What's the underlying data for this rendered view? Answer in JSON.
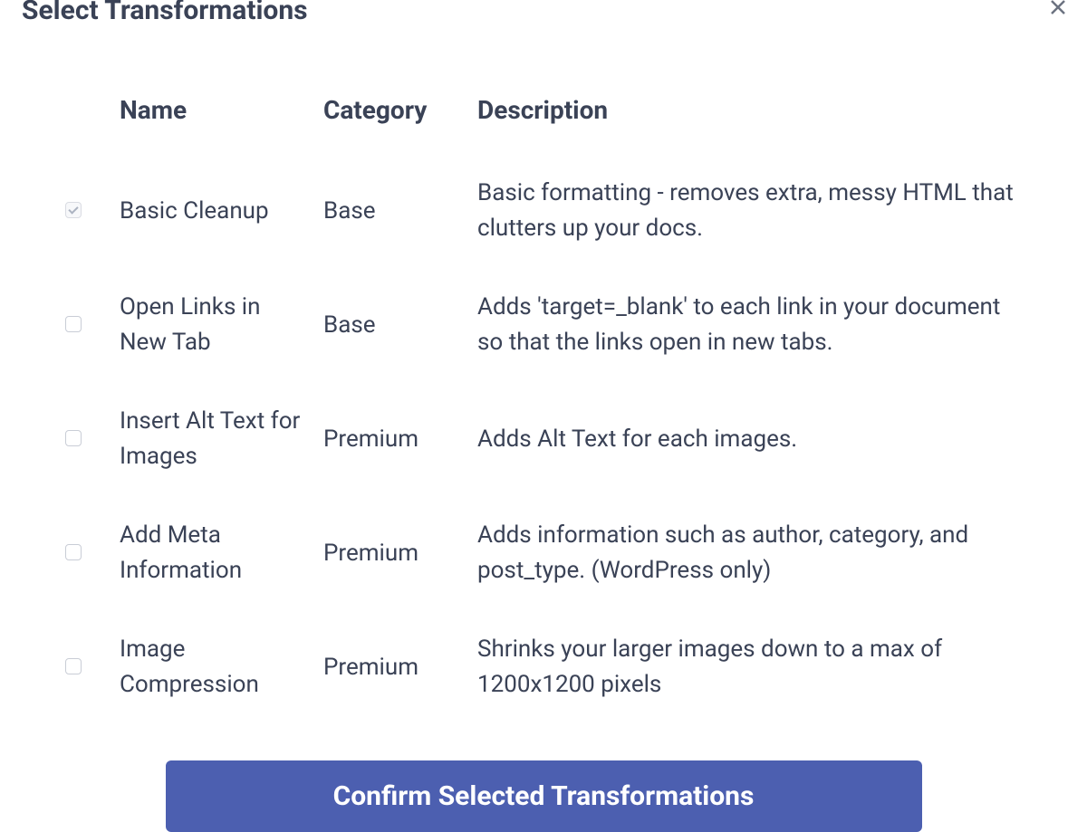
{
  "header": {
    "title": "Select Transformations"
  },
  "table": {
    "headers": {
      "name": "Name",
      "category": "Category",
      "description": "Description"
    },
    "rows": [
      {
        "checked": true,
        "disabled": true,
        "name": "Basic Cleanup",
        "category": "Base",
        "description": "Basic formatting - removes extra, messy HTML that clutters up your docs."
      },
      {
        "checked": false,
        "disabled": false,
        "name": "Open Links in New Tab",
        "category": "Base",
        "description": "Adds 'target=_blank' to each link in your document so that the links open in new tabs."
      },
      {
        "checked": false,
        "disabled": false,
        "name": "Insert Alt Text for Images",
        "category": "Premium",
        "description": "Adds Alt Text for each images."
      },
      {
        "checked": false,
        "disabled": false,
        "name": "Add Meta Information",
        "category": "Premium",
        "description": "Adds information such as author, category, and post_type. (WordPress only)"
      },
      {
        "checked": false,
        "disabled": false,
        "name": "Image Compression",
        "category": "Premium",
        "description": "Shrinks your larger images down to a max of 1200x1200 pixels"
      }
    ]
  },
  "buttons": {
    "confirm": "Confirm Selected Transformations"
  }
}
